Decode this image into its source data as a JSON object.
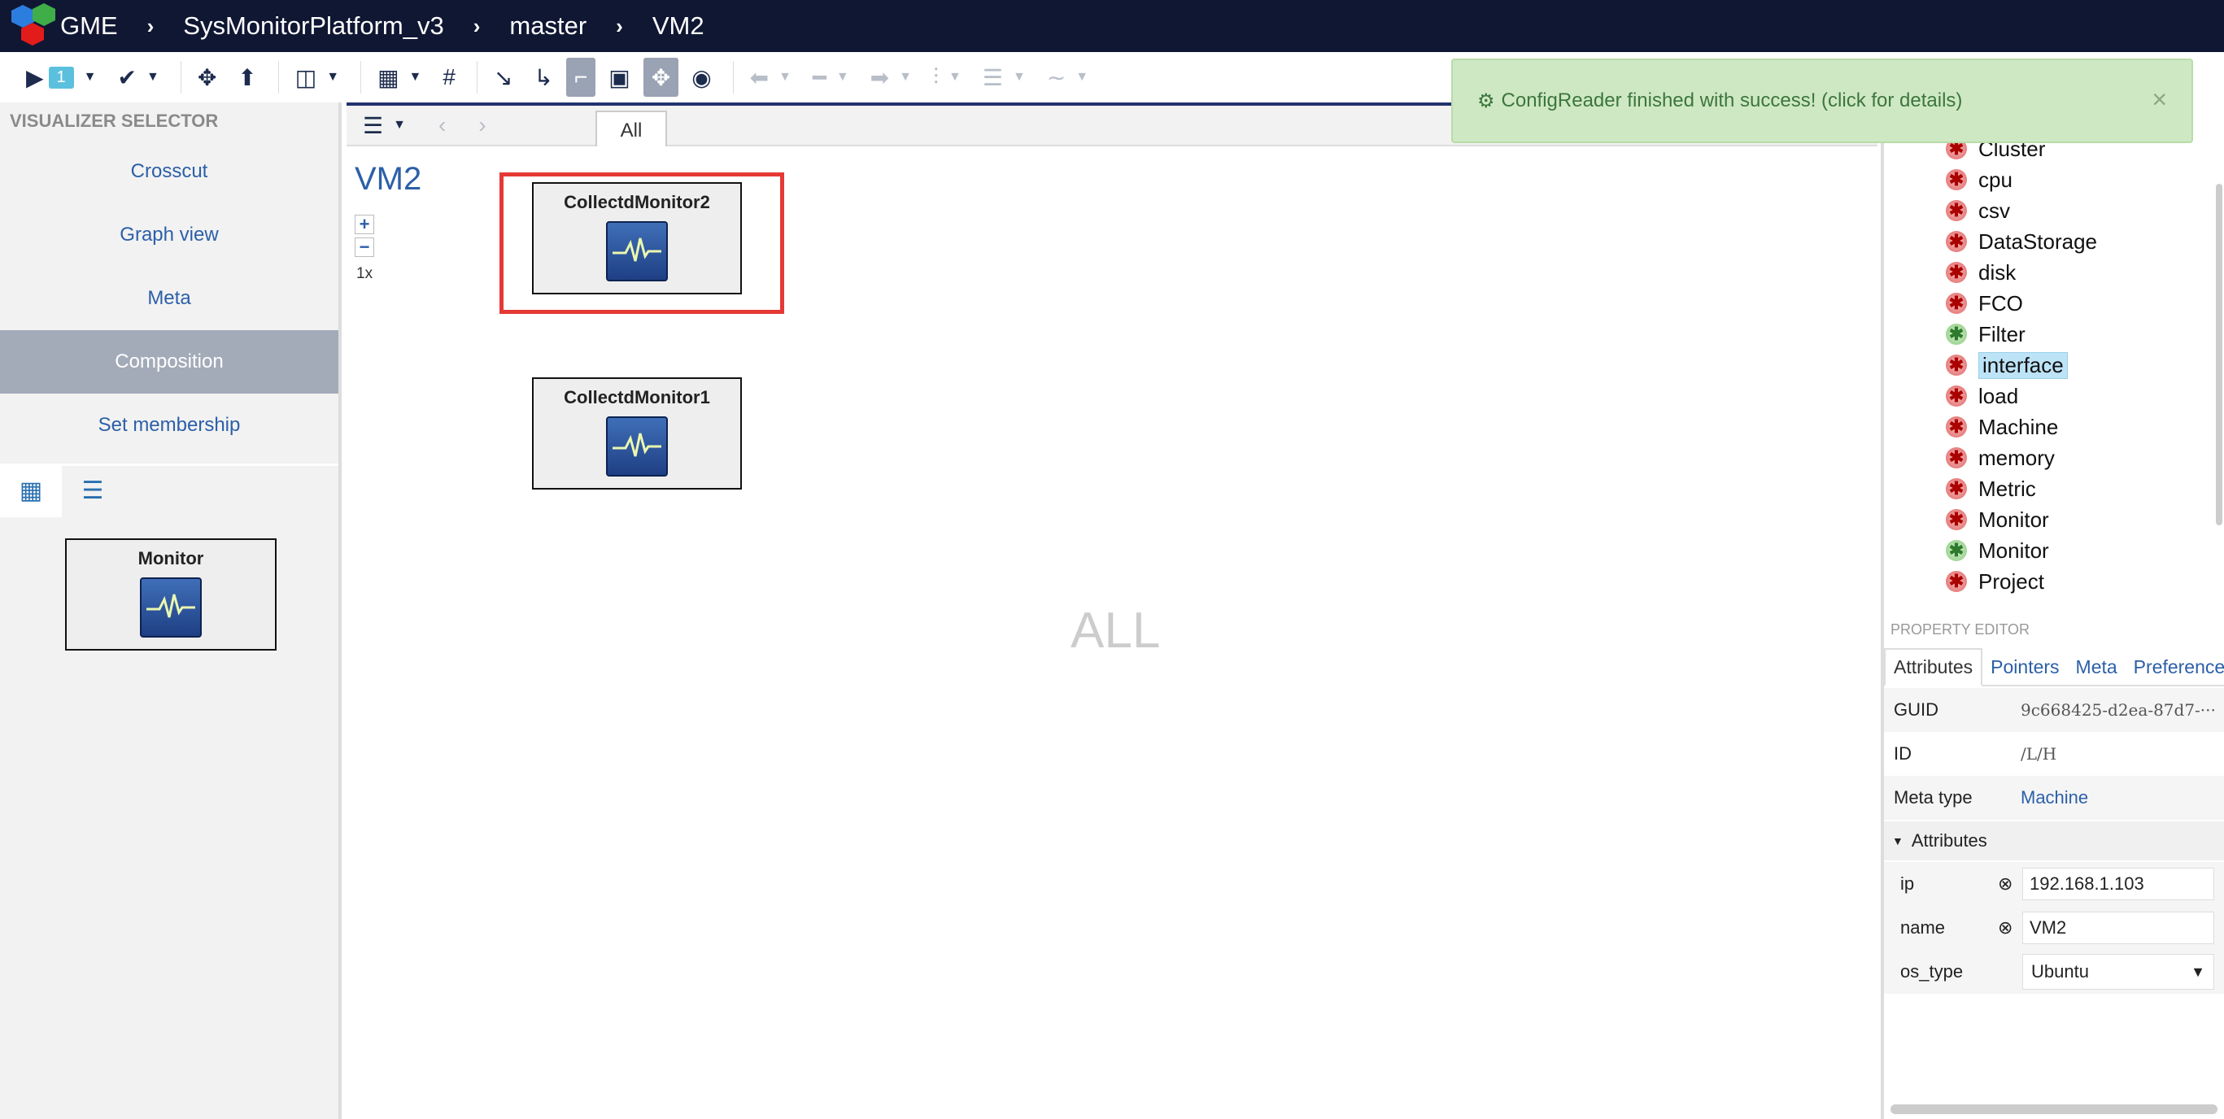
{
  "header": {
    "breadcrumbs": [
      "GME",
      "SysMonitorPlatform_v3",
      "master",
      "VM2"
    ]
  },
  "toolbar": {
    "run_badge": "1"
  },
  "visualizer": {
    "title": "VISUALIZER SELECTOR",
    "items": [
      "Crosscut",
      "Graph view",
      "Meta",
      "Composition",
      "Set membership"
    ],
    "active": "Composition",
    "palette_item": "Monitor"
  },
  "canvas": {
    "tab_label": "All",
    "title": "VM2",
    "zoom_level": "1x",
    "nodes": [
      "CollectdMonitor2",
      "CollectdMonitor1"
    ],
    "watermark": "ALL"
  },
  "notification": {
    "icon": "gear-icon",
    "text": "ConfigReader finished with success! (click for details)"
  },
  "tree": {
    "items": [
      {
        "label": "Cluster",
        "icon": "red"
      },
      {
        "label": "cpu",
        "icon": "red"
      },
      {
        "label": "csv",
        "icon": "red"
      },
      {
        "label": "DataStorage",
        "icon": "red"
      },
      {
        "label": "disk",
        "icon": "red"
      },
      {
        "label": "FCO",
        "icon": "red"
      },
      {
        "label": "Filter",
        "icon": "green"
      },
      {
        "label": "interface",
        "icon": "red",
        "selected": true
      },
      {
        "label": "load",
        "icon": "red"
      },
      {
        "label": "Machine",
        "icon": "red"
      },
      {
        "label": "memory",
        "icon": "red"
      },
      {
        "label": "Metric",
        "icon": "red"
      },
      {
        "label": "Monitor",
        "icon": "red"
      },
      {
        "label": "Monitor",
        "icon": "green"
      },
      {
        "label": "Project",
        "icon": "red"
      }
    ]
  },
  "property_editor": {
    "title": "PROPERTY EDITOR",
    "tabs": [
      "Attributes",
      "Pointers",
      "Meta",
      "Preferences"
    ],
    "active_tab": "Attributes",
    "guid_label": "GUID",
    "guid_value": "9c668425-d2ea-87d7-···",
    "id_label": "ID",
    "id_value": "/L/H",
    "meta_type_label": "Meta type",
    "meta_type_value": "Machine",
    "attributes_header": "Attributes",
    "attributes": [
      {
        "name": "ip",
        "value": "192.168.1.103"
      },
      {
        "name": "name",
        "value": "VM2"
      }
    ],
    "os_type_label": "os_type",
    "os_type_value": "Ubuntu"
  }
}
